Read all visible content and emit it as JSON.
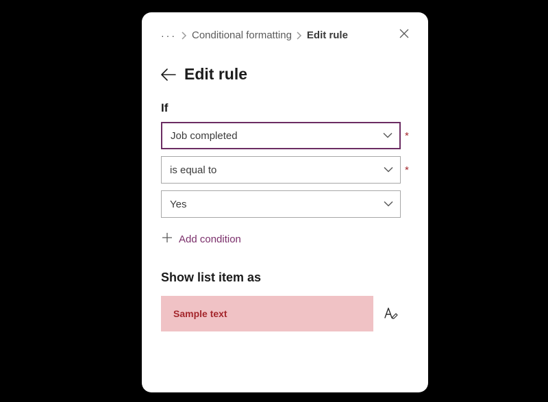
{
  "breadcrumb": {
    "parent": "Conditional formatting",
    "current": "Edit rule"
  },
  "title": "Edit rule",
  "condition": {
    "label": "If",
    "field": "Job completed",
    "operator": "is equal to",
    "value": "Yes",
    "addLabel": "Add condition"
  },
  "preview": {
    "label": "Show list item as",
    "sample": "Sample text"
  },
  "colors": {
    "accent": "#6b2c62",
    "swatchBg": "#f0c2c5",
    "swatchText": "#a4262c"
  }
}
